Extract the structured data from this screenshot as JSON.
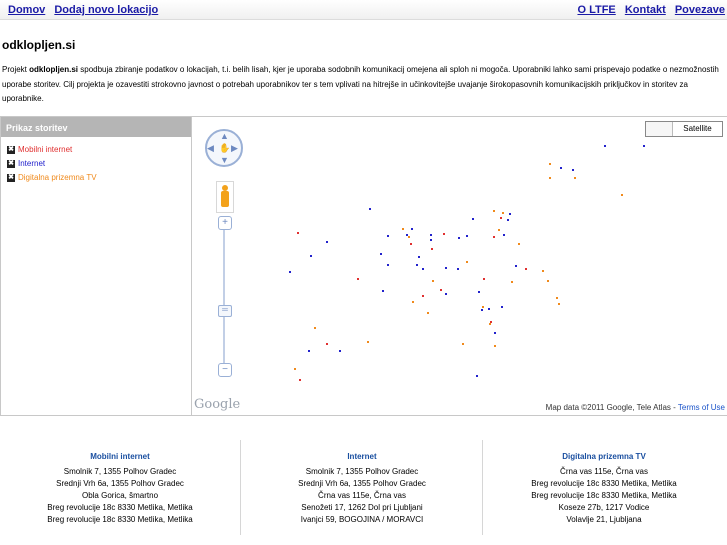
{
  "nav": {
    "left": [
      "Domov",
      "Dodaj novo lokacijo"
    ],
    "right": [
      "O LTFE",
      "Kontakt",
      "Povezave"
    ]
  },
  "site_title": "odklopljen.si",
  "intro": {
    "prefix": "Projekt ",
    "bold": "odklopljen.si",
    "text": " spodbuja zbiranje podatkov o lokacijah, t.i. belih lisah, kjer je uporaba sodobnih komunikacij omejena ali sploh ni mogoča. Uporabniki lahko sami prispevajo podatke o nezmožnostih uporabe storitev. Cilj projekta je ozavestiti strokovno javnost o potrebah uporabnikov ter s tem vplivati na hitrejše in učinkovitejše uvajanje širokopasovnih komunikacijskih priključkov in storitev za uporabnike."
  },
  "services_panel": {
    "title": "Prikaz storitev",
    "items": [
      {
        "label": "Mobilni internet",
        "color": "#e03030"
      },
      {
        "label": "Internet",
        "color": "#2222cc"
      },
      {
        "label": "Digitalna prizemna TV",
        "color": "#f08a1c"
      }
    ]
  },
  "map": {
    "type_buttons": [
      "",
      "Satellite"
    ],
    "logo": "Google",
    "attribution": "Map data ©2011 Google, Tele Atlas - ",
    "terms": "Terms of Use",
    "zoom_in": "+",
    "zoom_out": "−"
  },
  "columns": [
    {
      "title": "Mobilni internet",
      "lines": [
        "Smolnik 7, 1355 Polhov Gradec",
        "Srednji Vrh 6a, 1355 Polhov Gradec",
        "Obla Gorica, šmartno",
        "Breg revolucije 18c 8330 Metlika, Metlika",
        "Breg revolucije 18c 8330 Metlika, Metlika"
      ]
    },
    {
      "title": "Internet",
      "lines": [
        "Smolnik 7, 1355 Polhov Gradec",
        "Srednji Vrh 6a, 1355 Polhov Gradec",
        "Črna vas 115e, Črna vas",
        "Senožeti 17, 1262 Dol pri Ljubljani",
        "Ivanjci 59, BOGOJINA / MORAVCI"
      ]
    },
    {
      "title": "Digitalna prizemna TV",
      "lines": [
        "Črna vas 115e, Črna vas",
        "Breg revolucije 18c 8330 Metlika, Metlika",
        "Breg revolucije 18c 8330 Metlika, Metlika",
        "Koseze 27b, 1217 Vodice",
        "Volavlje 21, Ljubljana"
      ]
    }
  ]
}
